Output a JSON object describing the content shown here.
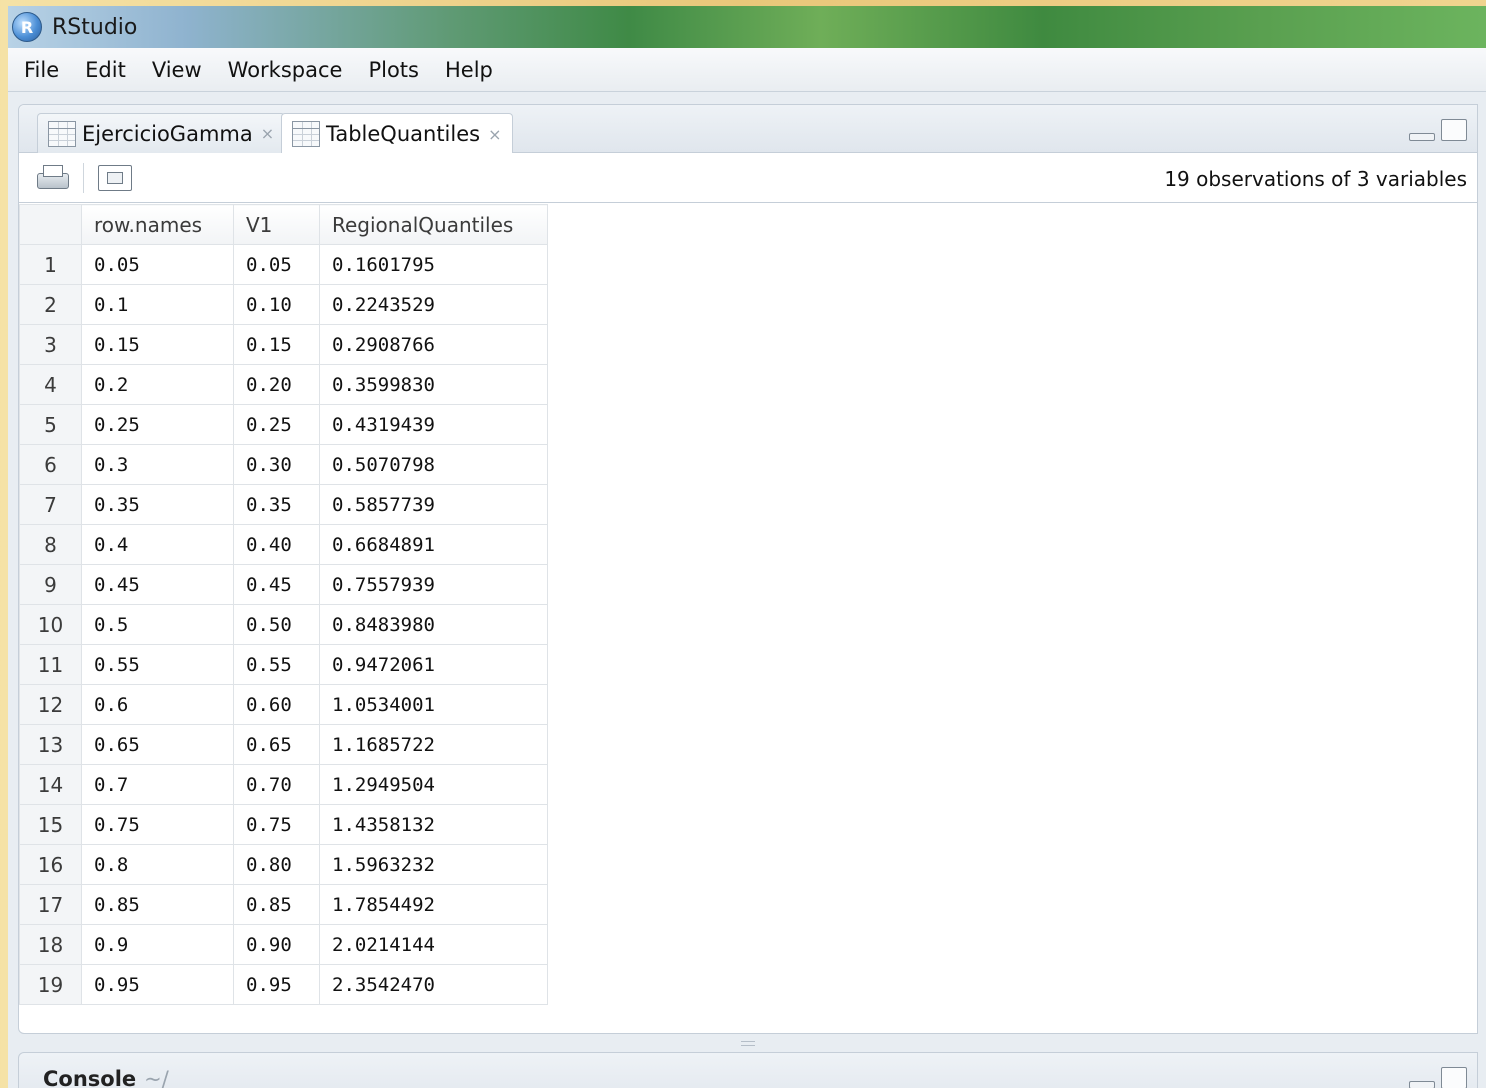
{
  "window": {
    "title": "RStudio",
    "logo_letter": "R"
  },
  "menu": [
    "File",
    "Edit",
    "View",
    "Workspace",
    "Plots",
    "Help"
  ],
  "tabs": [
    {
      "label": "EjercicioGamma",
      "close": "×"
    },
    {
      "label": "TableQuantiles",
      "close": "×"
    }
  ],
  "toolbar": {
    "observations": "19 observations of 3 variables"
  },
  "table": {
    "columns": [
      "",
      "row.names",
      "V1",
      "RegionalQuantiles"
    ],
    "rows": [
      [
        "1",
        "0.05",
        "0.05",
        "0.1601795"
      ],
      [
        "2",
        "0.1",
        "0.10",
        "0.2243529"
      ],
      [
        "3",
        "0.15",
        "0.15",
        "0.2908766"
      ],
      [
        "4",
        "0.2",
        "0.20",
        "0.3599830"
      ],
      [
        "5",
        "0.25",
        "0.25",
        "0.4319439"
      ],
      [
        "6",
        "0.3",
        "0.30",
        "0.5070798"
      ],
      [
        "7",
        "0.35",
        "0.35",
        "0.5857739"
      ],
      [
        "8",
        "0.4",
        "0.40",
        "0.6684891"
      ],
      [
        "9",
        "0.45",
        "0.45",
        "0.7557939"
      ],
      [
        "10",
        "0.5",
        "0.50",
        "0.8483980"
      ],
      [
        "11",
        "0.55",
        "0.55",
        "0.9472061"
      ],
      [
        "12",
        "0.6",
        "0.60",
        "1.0534001"
      ],
      [
        "13",
        "0.65",
        "0.65",
        "1.1685722"
      ],
      [
        "14",
        "0.7",
        "0.70",
        "1.2949504"
      ],
      [
        "15",
        "0.75",
        "0.75",
        "1.4358132"
      ],
      [
        "16",
        "0.8",
        "0.80",
        "1.5963232"
      ],
      [
        "17",
        "0.85",
        "0.85",
        "1.7854492"
      ],
      [
        "18",
        "0.9",
        "0.90",
        "2.0214144"
      ],
      [
        "19",
        "0.95",
        "0.95",
        "2.3542470"
      ]
    ]
  },
  "console": {
    "title": "Console",
    "path": "~/"
  }
}
